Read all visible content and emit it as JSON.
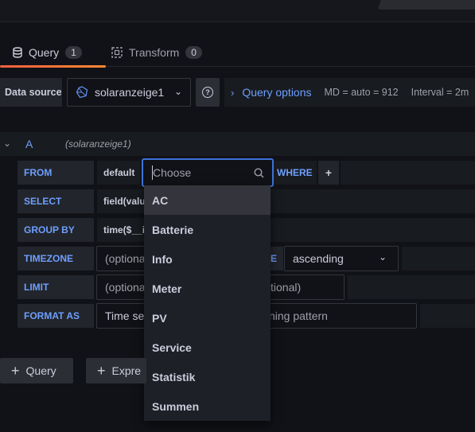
{
  "tabs": [
    {
      "label": "Query",
      "count": "1"
    },
    {
      "label": "Transform",
      "count": "0"
    }
  ],
  "datasource": {
    "label": "Data source",
    "selected": "solaranzeige1",
    "help": "?",
    "query_options_label": "Query options",
    "md": "MD = auto = 912",
    "interval": "Interval = 2m"
  },
  "query": {
    "ref": "A",
    "datasource_name": "(solaranzeige1)",
    "rows": {
      "from": {
        "label": "FROM",
        "policy": "default",
        "measurement_placeholder": "Choose",
        "where_label": "WHERE",
        "add": "+"
      },
      "select": {
        "label": "SELECT",
        "value": "field(valu"
      },
      "group_by": {
        "label": "GROUP BY",
        "value": "time($__i"
      },
      "timezone": {
        "label": "TIMEZONE",
        "placeholder": "(optiona",
        "order_label_fragment": "E",
        "order_value": "ascending"
      },
      "limit": {
        "label": "LIMIT",
        "placeholder": "(optiona",
        "slimit_fragment": "tional)"
      },
      "format_as": {
        "label": "FORMAT AS",
        "value": "Time se",
        "alias_fragment": "ning pattern"
      }
    }
  },
  "measurement_options": [
    "AC",
    "Batterie",
    "Info",
    "Meter",
    "PV",
    "Service",
    "Statistik",
    "Summen"
  ],
  "buttons": {
    "add_query": "Query",
    "add_expression": "Expre"
  },
  "colors": {
    "accent_blue": "#6e9fff",
    "focus_border": "#3d71d9",
    "tab_underline": "#f55f3e",
    "background": "#111217"
  }
}
